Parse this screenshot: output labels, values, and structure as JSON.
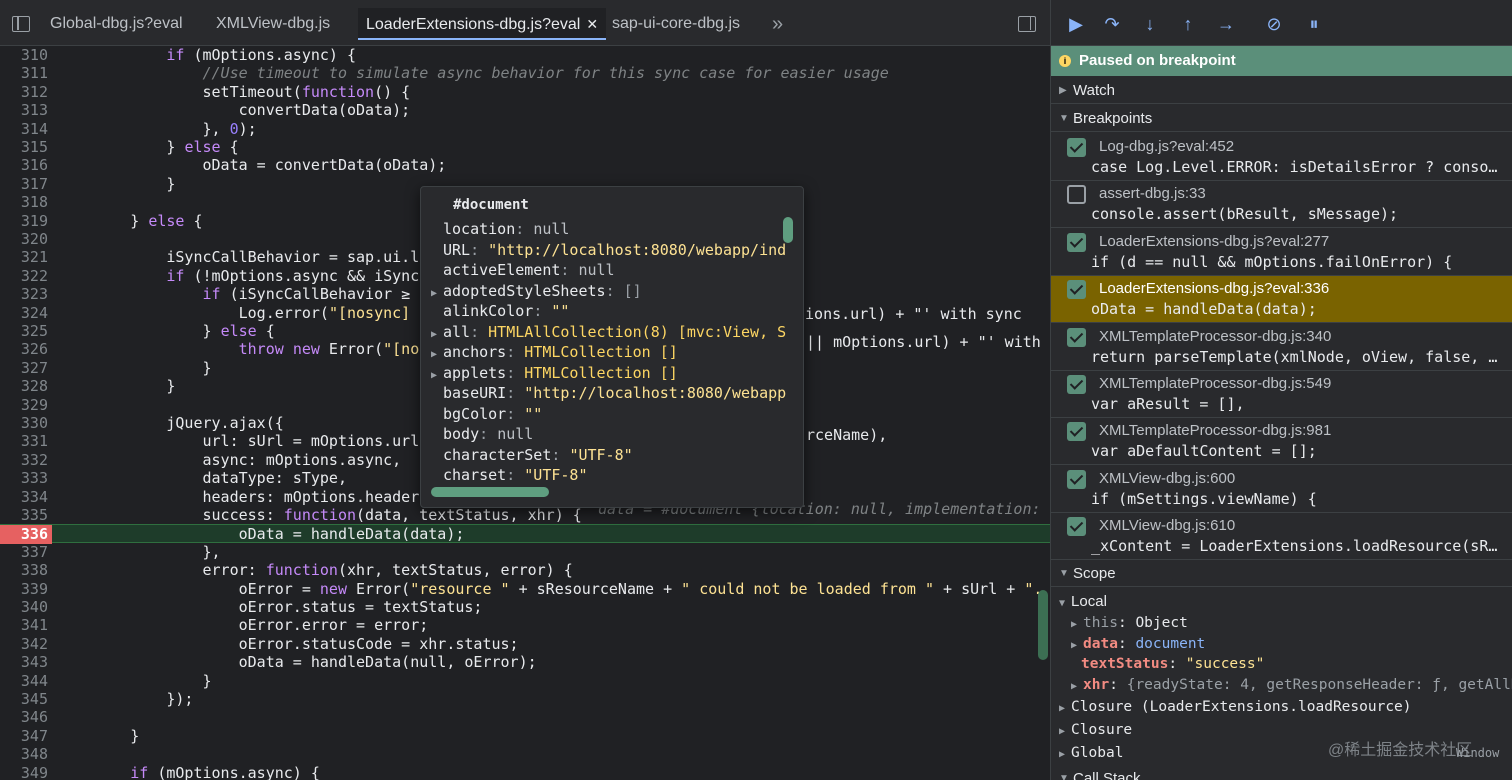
{
  "tabs": [
    {
      "label": "Global-dbg.js?eval",
      "active": false
    },
    {
      "label": "XMLView-dbg.js",
      "active": false
    },
    {
      "label": "LoaderExtensions-dbg.js?eval",
      "active": true
    },
    {
      "label": "sap-ui-core-dbg.js",
      "active": false
    }
  ],
  "tab_more": "»",
  "tab_close": "✕",
  "code_lines": [
    {
      "n": "310",
      "src": "            if (mOptions.async) {"
    },
    {
      "n": "311",
      "src": "                //Use timeout to simulate async behavior for this sync case for easier usage"
    },
    {
      "n": "312",
      "src": "                setTimeout(function() {"
    },
    {
      "n": "313",
      "src": "                    convertData(oData);"
    },
    {
      "n": "314",
      "src": "                }, 0);"
    },
    {
      "n": "315",
      "src": "            } else {"
    },
    {
      "n": "316",
      "src": "                oData = convertData(oData);"
    },
    {
      "n": "317",
      "src": "            }"
    },
    {
      "n": "318",
      "src": ""
    },
    {
      "n": "319",
      "src": "        } else {"
    },
    {
      "n": "320",
      "src": ""
    },
    {
      "n": "321",
      "src": "            iSyncCallBehavior = sap.ui.lo"
    },
    {
      "n": "322",
      "src": "            if (!mOptions.async && iSyncC"
    },
    {
      "n": "323",
      "src": "                if (iSyncCallBehavior ≥"
    },
    {
      "n": "324",
      "src": "                    Log.error(\"[nosync] "
    },
    {
      "n": "325",
      "src": "                } else {"
    },
    {
      "n": "326",
      "src": "                    throw new Error(\"[no"
    },
    {
      "n": "327",
      "src": "                }"
    },
    {
      "n": "328",
      "src": "            }"
    },
    {
      "n": "329",
      "src": ""
    },
    {
      "n": "330",
      "src": "            jQuery.ajax({"
    },
    {
      "n": "331",
      "src": "                url: sUrl = mOptions.url"
    },
    {
      "n": "332",
      "src": "                async: mOptions.async,"
    },
    {
      "n": "333",
      "src": "                dataType: sType,"
    },
    {
      "n": "334",
      "src": "                headers: mOptions.header"
    },
    {
      "n": "335",
      "src": "                success: function(data, textStatus, xhr) {"
    },
    {
      "n": "336",
      "src": "                    oData = handleData(data);"
    },
    {
      "n": "337",
      "src": "                },"
    },
    {
      "n": "338",
      "src": "                error: function(xhr, textStatus, error) {"
    },
    {
      "n": "339",
      "src": "                    oError = new Error(\"resource \" + sResourceName + \" could not be loaded from \" + sUrl + \"."
    },
    {
      "n": "340",
      "src": "                    oError.status = textStatus;"
    },
    {
      "n": "341",
      "src": "                    oError.error = error;"
    },
    {
      "n": "342",
      "src": "                    oError.statusCode = xhr.status;"
    },
    {
      "n": "343",
      "src": "                    oData = handleData(null, oError);"
    },
    {
      "n": "344",
      "src": "                }"
    },
    {
      "n": "345",
      "src": "            });"
    },
    {
      "n": "346",
      "src": ""
    },
    {
      "n": "347",
      "src": "        }"
    },
    {
      "n": "348",
      "src": ""
    },
    {
      "n": "349",
      "src": "        if (mOptions.async) {"
    }
  ],
  "right_fragments": {
    "l324": "tions.url) + \"' with sync",
    "l326": "|| mOptions.url) + \"' with",
    "l331": "rceName),",
    "l335": "data = #document {location: null, implementation:"
  },
  "current_line": "336",
  "popover": {
    "title": "#document",
    "rows": [
      {
        "tri": "",
        "key": "location",
        "val": "null",
        "cls": "nul"
      },
      {
        "tri": "",
        "key": "URL",
        "val": "\"http://localhost:8080/webapp/ind",
        "cls": "str"
      },
      {
        "tri": "",
        "key": "activeElement",
        "val": "null",
        "cls": "nul"
      },
      {
        "tri": "▶",
        "key": "adoptedStyleSheets",
        "val": "[]",
        "cls": "dim"
      },
      {
        "tri": "",
        "key": "alinkColor",
        "val": "\"\"",
        "cls": "str"
      },
      {
        "tri": "▶",
        "key": "all",
        "val": "HTMLAllCollection(8) [mvc:View, S",
        "cls": "typ"
      },
      {
        "tri": "▶",
        "key": "anchors",
        "val": "HTMLCollection []",
        "cls": "typ"
      },
      {
        "tri": "▶",
        "key": "applets",
        "val": "HTMLCollection []",
        "cls": "typ"
      },
      {
        "tri": "",
        "key": "baseURI",
        "val": "\"http://localhost:8080/webapp",
        "cls": "str"
      },
      {
        "tri": "",
        "key": "bgColor",
        "val": "\"\"",
        "cls": "str"
      },
      {
        "tri": "",
        "key": "body",
        "val": "null",
        "cls": "nul"
      },
      {
        "tri": "",
        "key": "characterSet",
        "val": "\"UTF-8\"",
        "cls": "str"
      },
      {
        "tri": "",
        "key": "charset",
        "val": "\"UTF-8\"",
        "cls": "str"
      }
    ]
  },
  "debugger": {
    "paused_label": "Paused on breakpoint",
    "sections": {
      "watch": "Watch",
      "breakpoints": "Breakpoints",
      "scope": "Scope",
      "call_stack": "Call Stack"
    },
    "breakpoints": [
      {
        "name": "Log-dbg.js?eval:452",
        "code": "case Log.Level.ERROR: isDetailsError ? conso…",
        "checked": true,
        "hit": false
      },
      {
        "name": "assert-dbg.js:33",
        "code": "console.assert(bResult, sMessage);",
        "checked": false,
        "hit": false
      },
      {
        "name": "LoaderExtensions-dbg.js?eval:277",
        "code": "if (d == null && mOptions.failOnError) {",
        "checked": true,
        "hit": false
      },
      {
        "name": "LoaderExtensions-dbg.js?eval:336",
        "code": "oData = handleData(data);",
        "checked": true,
        "hit": true
      },
      {
        "name": "XMLTemplateProcessor-dbg.js:340",
        "code": "return parseTemplate(xmlNode, oView, false, …",
        "checked": true,
        "hit": false
      },
      {
        "name": "XMLTemplateProcessor-dbg.js:549",
        "code": "var aResult = [],",
        "checked": true,
        "hit": false
      },
      {
        "name": "XMLTemplateProcessor-dbg.js:981",
        "code": "var aDefaultContent = [];",
        "checked": true,
        "hit": false
      },
      {
        "name": "XMLView-dbg.js:600",
        "code": "if (mSettings.viewName) {",
        "checked": true,
        "hit": false
      },
      {
        "name": "XMLView-dbg.js:610",
        "code": "_xContent = LoaderExtensions.loadResource(sR…",
        "checked": true,
        "hit": false
      }
    ],
    "scope": {
      "local_label": "Local",
      "this_key": "this",
      "this_val": "Object",
      "data_key": "data",
      "data_val": "document",
      "textStatus_key": "textStatus",
      "textStatus_val": "\"success\"",
      "xhr_key": "xhr",
      "xhr_val": "{readyState: 4, getResponseHeader: ƒ, getAllR…",
      "closure1": "Closure (LoaderExtensions.loadResource)",
      "closure2": "Closure",
      "global": "Global",
      "window_label": "Window"
    },
    "watermark": "@稀土掘金技术社区"
  }
}
